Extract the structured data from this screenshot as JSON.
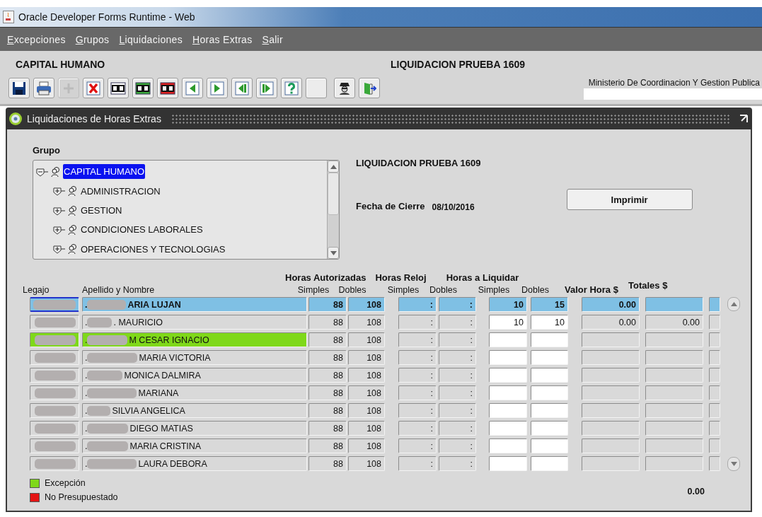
{
  "window": {
    "title": "Oracle Developer Forms Runtime - Web"
  },
  "menu": [
    "Excepciones",
    "Grupos",
    "Liquidaciones",
    "Horas Extras",
    "Salir"
  ],
  "header": {
    "group": "CAPITAL HUMANO",
    "liquidacion": "LIQUIDACION PRUEBA 1609",
    "organization": "Ministerio De Coordinacion Y Gestion Publica"
  },
  "toolbar": [
    {
      "kind": "save",
      "disabled": false
    },
    {
      "kind": "print",
      "disabled": false
    },
    {
      "kind": "insert",
      "disabled": true
    },
    {
      "kind": "delete",
      "disabled": false
    },
    {
      "kind": "enter-query",
      "disabled": false
    },
    {
      "kind": "execute-query",
      "disabled": false
    },
    {
      "kind": "cancel-query",
      "disabled": false
    },
    {
      "kind": "previous",
      "disabled": false
    },
    {
      "kind": "next",
      "disabled": false
    },
    {
      "kind": "previous-block",
      "disabled": false
    },
    {
      "kind": "next-block",
      "disabled": false
    },
    {
      "kind": "help",
      "disabled": false
    },
    {
      "kind": "blank",
      "disabled": false
    },
    {
      "kind": "agent",
      "disabled": false
    },
    {
      "kind": "exit",
      "disabled": false
    }
  ],
  "form": {
    "title": "Liquidaciones de Horas Extras",
    "group_label": "Grupo",
    "tree": [
      {
        "label": "CAPITAL HUMANO",
        "selected": true,
        "expanded": true,
        "children": [
          {
            "label": "ADMINISTRACION",
            "selected": false,
            "expanded": false
          },
          {
            "label": "GESTION",
            "selected": false,
            "expanded": false
          },
          {
            "label": "CONDICIONES LABORALES",
            "selected": false,
            "expanded": false
          },
          {
            "label": "OPERACIONES Y TECNOLOGIAS",
            "selected": false,
            "expanded": false
          }
        ]
      }
    ],
    "liquidacion": "LIQUIDACION PRUEBA 1609",
    "fecha_label": "Fecha de Cierre",
    "fecha": "08/10/2016",
    "print_button": "Imprimir"
  },
  "table": {
    "groups": [
      "Horas Autorizadas",
      "Horas Reloj",
      "Horas a Liquidar"
    ],
    "columns": [
      "Legajo",
      "Apellido y Nombre",
      "Simples",
      "Dobles",
      "Simples",
      "Dobles",
      "Simples",
      "Dobles",
      "Valor Hora $",
      "Totales $"
    ],
    "rows": [
      {
        "selected": true,
        "exception": false,
        "lead": ".",
        "name": "ARIA LUJAN",
        "aut_simples": "88",
        "aut_dobles": "108",
        "reloj_simples": ":",
        "reloj_dobles": ":",
        "liq_simples": "10",
        "liq_dobles": "15",
        "valor_hora": "0.00"
      },
      {
        "selected": false,
        "exception": false,
        "lead": ".",
        "name": ". MAURICIO",
        "aut_simples": "88",
        "aut_dobles": "108",
        "reloj_simples": ":",
        "reloj_dobles": ":",
        "liq_simples": "10",
        "liq_dobles": "10",
        "valor_hora": "0.00",
        "total": "0.00"
      },
      {
        "selected": false,
        "exception": true,
        "lead": ".",
        "name": "M CESAR IGNACIO",
        "aut_simples": "88",
        "aut_dobles": "108",
        "reloj_simples": ":",
        "reloj_dobles": ":"
      },
      {
        "selected": false,
        "exception": false,
        "lead": ".",
        "name": "MARIA VICTORIA",
        "aut_simples": "88",
        "aut_dobles": "108",
        "reloj_simples": ":",
        "reloj_dobles": ":"
      },
      {
        "selected": false,
        "exception": false,
        "lead": ".",
        "name": "MONICA DALMIRA",
        "aut_simples": "88",
        "aut_dobles": "108",
        "reloj_simples": ":",
        "reloj_dobles": ":"
      },
      {
        "selected": false,
        "exception": false,
        "lead": ".",
        "name": "MARIANA",
        "aut_simples": "88",
        "aut_dobles": "108",
        "reloj_simples": ":",
        "reloj_dobles": ":"
      },
      {
        "selected": false,
        "exception": false,
        "lead": ".",
        "name": "SILVIA ANGELICA",
        "aut_simples": "88",
        "aut_dobles": "108",
        "reloj_simples": ":",
        "reloj_dobles": ":"
      },
      {
        "selected": false,
        "exception": false,
        "lead": ".",
        "name": "DIEGO MATIAS",
        "aut_simples": "88",
        "aut_dobles": "108",
        "reloj_simples": ":",
        "reloj_dobles": ":"
      },
      {
        "selected": false,
        "exception": false,
        "lead": ".",
        "name": "MARIA CRISTINA",
        "aut_simples": "88",
        "aut_dobles": "108",
        "reloj_simples": ":",
        "reloj_dobles": ":"
      },
      {
        "selected": false,
        "exception": false,
        "lead": ".",
        "name": "LAURA DEBORA",
        "aut_simples": "88",
        "aut_dobles": "108",
        "reloj_simples": ":",
        "reloj_dobles": ":"
      }
    ]
  },
  "legend": [
    {
      "label": "Excepción",
      "color": "#7fd81a"
    },
    {
      "label": "No Presupuestado",
      "color": "#e41414"
    }
  ],
  "total": "0.00"
}
